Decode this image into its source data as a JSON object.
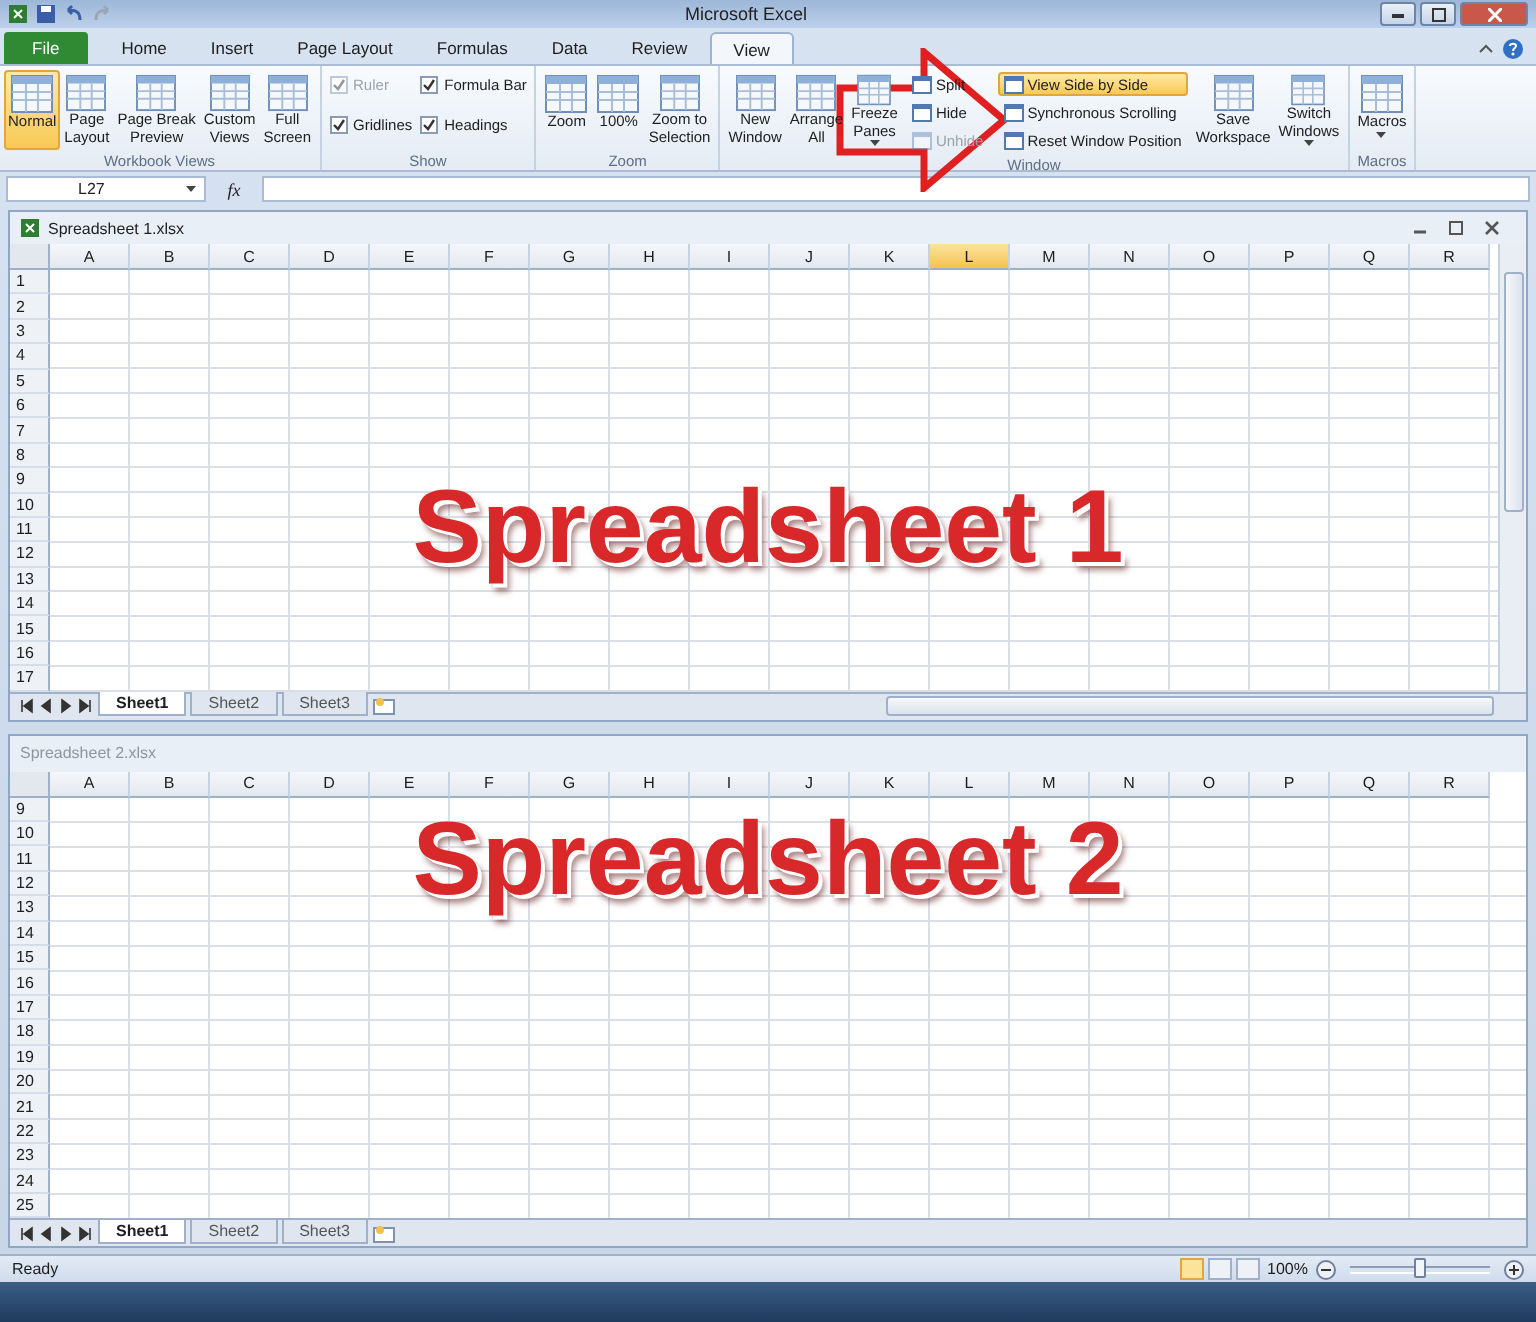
{
  "window": {
    "title": "Microsoft Excel"
  },
  "tabs": [
    {
      "label": "File",
      "kind": "file",
      "selected": false
    },
    {
      "label": "Home",
      "kind": "tab",
      "selected": false
    },
    {
      "label": "Insert",
      "kind": "tab",
      "selected": false
    },
    {
      "label": "Page Layout",
      "kind": "tab",
      "selected": false
    },
    {
      "label": "Formulas",
      "kind": "tab",
      "selected": false
    },
    {
      "label": "Data",
      "kind": "tab",
      "selected": false
    },
    {
      "label": "Review",
      "kind": "tab",
      "selected": false
    },
    {
      "label": "View",
      "kind": "tab",
      "selected": true
    }
  ],
  "ribbon": {
    "groups": [
      {
        "label": "Workbook Views",
        "items": [
          {
            "kind": "large",
            "lines": [
              "Normal"
            ],
            "selected": true,
            "dropdown": false
          },
          {
            "kind": "large",
            "lines": [
              "Page",
              "Layout"
            ],
            "selected": false,
            "dropdown": false
          },
          {
            "kind": "large",
            "lines": [
              "Page Break",
              "Preview"
            ],
            "selected": false,
            "dropdown": false
          },
          {
            "kind": "large",
            "lines": [
              "Custom",
              "Views"
            ],
            "selected": false,
            "dropdown": false
          },
          {
            "kind": "large",
            "lines": [
              "Full",
              "Screen"
            ],
            "selected": false,
            "dropdown": false
          }
        ]
      },
      {
        "label": "Show",
        "items": [
          {
            "kind": "checks",
            "items": [
              {
                "label": "Ruler",
                "checked": true,
                "disabled": true
              },
              {
                "label": "Gridlines",
                "checked": true,
                "disabled": false
              }
            ]
          },
          {
            "kind": "checks",
            "items": [
              {
                "label": "Formula Bar",
                "checked": true,
                "disabled": false
              },
              {
                "label": "Headings",
                "checked": true,
                "disabled": false
              }
            ]
          }
        ]
      },
      {
        "label": "Zoom",
        "items": [
          {
            "kind": "large",
            "lines": [
              "Zoom"
            ],
            "selected": false,
            "dropdown": false
          },
          {
            "kind": "large",
            "lines": [
              "100%"
            ],
            "selected": false,
            "dropdown": false
          },
          {
            "kind": "large",
            "lines": [
              "Zoom to",
              "Selection"
            ],
            "selected": false,
            "dropdown": false
          }
        ]
      },
      {
        "label": "Window",
        "items": [
          {
            "kind": "large",
            "lines": [
              "New",
              "Window"
            ],
            "selected": false,
            "dropdown": false
          },
          {
            "kind": "large",
            "lines": [
              "Arrange",
              "All"
            ],
            "selected": false,
            "dropdown": false
          },
          {
            "kind": "large",
            "lines": [
              "Freeze",
              "Panes"
            ],
            "selected": false,
            "dropdown": true
          },
          {
            "kind": "small",
            "items": [
              {
                "label": "Split",
                "selected": false,
                "disabled": false
              },
              {
                "label": "Hide",
                "selected": false,
                "disabled": false
              },
              {
                "label": "Unhide",
                "selected": false,
                "disabled": true
              }
            ]
          },
          {
            "kind": "small",
            "items": [
              {
                "label": "View Side by Side",
                "selected": true,
                "disabled": false
              },
              {
                "label": "Synchronous Scrolling",
                "selected": false,
                "disabled": false
              },
              {
                "label": "Reset Window Position",
                "selected": false,
                "disabled": false
              }
            ]
          },
          {
            "kind": "large",
            "lines": [
              "Save",
              "Workspace"
            ],
            "selected": false,
            "dropdown": false
          },
          {
            "kind": "large",
            "lines": [
              "Switch",
              "Windows"
            ],
            "selected": false,
            "dropdown": true
          }
        ]
      },
      {
        "label": "Macros",
        "items": [
          {
            "kind": "large",
            "lines": [
              "Macros"
            ],
            "selected": false,
            "dropdown": true
          }
        ]
      }
    ]
  },
  "formula_bar": {
    "name_box": "L27",
    "function_label": "fx"
  },
  "workbooks": [
    {
      "title": "Spreadsheet 1.xlsx",
      "active": true,
      "overlay_text": "Spreadsheet 1",
      "columns": [
        {
          "label": "A",
          "selected": false
        },
        {
          "label": "B",
          "selected": false
        },
        {
          "label": "C",
          "selected": false
        },
        {
          "label": "D",
          "selected": false
        },
        {
          "label": "E",
          "selected": false
        },
        {
          "label": "F",
          "selected": false
        },
        {
          "label": "G",
          "selected": false
        },
        {
          "label": "H",
          "selected": false
        },
        {
          "label": "I",
          "selected": false
        },
        {
          "label": "J",
          "selected": false
        },
        {
          "label": "K",
          "selected": false
        },
        {
          "label": "L",
          "selected": true
        },
        {
          "label": "M",
          "selected": false
        },
        {
          "label": "N",
          "selected": false
        },
        {
          "label": "O",
          "selected": false
        },
        {
          "label": "P",
          "selected": false
        },
        {
          "label": "Q",
          "selected": false
        },
        {
          "label": "R",
          "selected": false
        }
      ],
      "rows": [
        "1",
        "2",
        "3",
        "4",
        "5",
        "6",
        "7",
        "8",
        "9",
        "10",
        "11",
        "12",
        "13",
        "14",
        "15",
        "16",
        "17"
      ],
      "sheets": [
        {
          "label": "Sheet1",
          "selected": true
        },
        {
          "label": "Sheet2",
          "selected": false
        },
        {
          "label": "Sheet3",
          "selected": false
        }
      ]
    },
    {
      "title": "Spreadsheet 2.xlsx",
      "active": false,
      "overlay_text": "Spreadsheet 2",
      "columns": [
        {
          "label": "A",
          "selected": false
        },
        {
          "label": "B",
          "selected": false
        },
        {
          "label": "C",
          "selected": false
        },
        {
          "label": "D",
          "selected": false
        },
        {
          "label": "E",
          "selected": false
        },
        {
          "label": "F",
          "selected": false
        },
        {
          "label": "G",
          "selected": false
        },
        {
          "label": "H",
          "selected": false
        },
        {
          "label": "I",
          "selected": false
        },
        {
          "label": "J",
          "selected": false
        },
        {
          "label": "K",
          "selected": false
        },
        {
          "label": "L",
          "selected": false
        },
        {
          "label": "M",
          "selected": false
        },
        {
          "label": "N",
          "selected": false
        },
        {
          "label": "O",
          "selected": false
        },
        {
          "label": "P",
          "selected": false
        },
        {
          "label": "Q",
          "selected": false
        },
        {
          "label": "R",
          "selected": false
        }
      ],
      "rows": [
        "9",
        "10",
        "11",
        "12",
        "13",
        "14",
        "15",
        "16",
        "17",
        "18",
        "19",
        "20",
        "21",
        "22",
        "23",
        "24",
        "25"
      ],
      "sheets": [
        {
          "label": "Sheet1",
          "selected": true
        },
        {
          "label": "Sheet2",
          "selected": false
        },
        {
          "label": "Sheet3",
          "selected": false
        }
      ]
    }
  ],
  "status_bar": {
    "text": "Ready",
    "zoom": "100%",
    "zoom_level": {
      "level": 0.5
    },
    "views": [
      {
        "selected": true
      },
      {
        "selected": false
      },
      {
        "selected": false
      }
    ]
  }
}
